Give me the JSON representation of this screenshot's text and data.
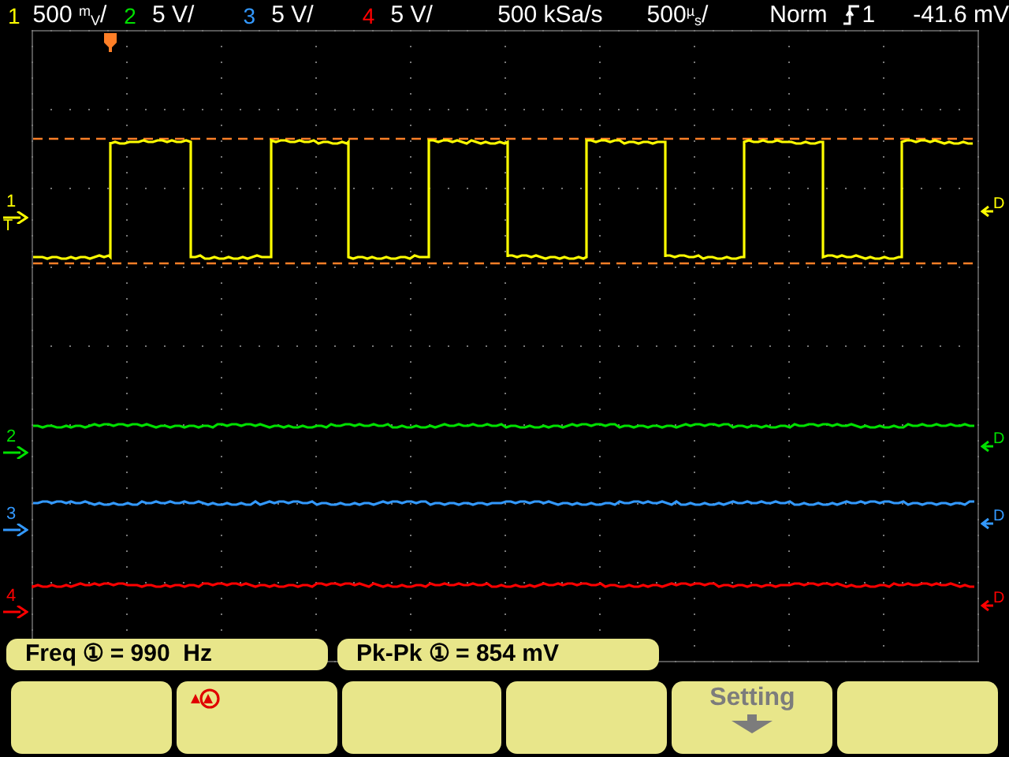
{
  "channels": [
    {
      "number": "1",
      "scale": "500 $^{m}$$_{V}$/",
      "color": "#ffff00",
      "marker_label": "1",
      "coupling": "D"
    },
    {
      "number": "2",
      "scale": "5 V/",
      "color": "#00e000",
      "marker_label": "2",
      "coupling": "D"
    },
    {
      "number": "3",
      "scale": "5 V/",
      "color": "#3399ff",
      "marker_label": "3",
      "coupling": "D"
    },
    {
      "number": "4",
      "scale": "5 V/",
      "color": "#ff0000",
      "marker_label": "4",
      "coupling": "D"
    }
  ],
  "acquisition": {
    "sample_rate": "500 kSa/s",
    "timebase": "500$^{µ}$$_{s}$/"
  },
  "trigger": {
    "mode": "Norm",
    "source": "1",
    "reading": "-41.6 mV",
    "marker": "T"
  },
  "measurements": [
    {
      "text": "Freq ① = 990  Hz"
    },
    {
      "text": "Pk-Pk ① = 854 mV"
    }
  ],
  "softkeys": [
    {
      "kind": "blank"
    },
    {
      "kind": "icon"
    },
    {
      "kind": "blank"
    },
    {
      "kind": "blank"
    },
    {
      "kind": "text",
      "label": "Setting",
      "disabled": true
    },
    {
      "kind": "blank"
    }
  ]
}
